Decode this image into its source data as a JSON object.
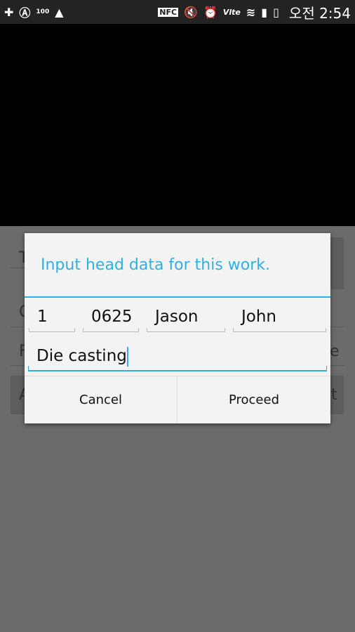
{
  "status_bar": {
    "icons": [
      "plus-icon",
      "a-circle-icon",
      "battery-100-icon",
      "warning-icon",
      "nfc-icon",
      "mute-icon",
      "alarm-icon",
      "volte-icon",
      "wifi-lock-icon",
      "signal-icon",
      "battery-charging-icon"
    ],
    "nfc": "NFC",
    "volte": "Vlte",
    "battery_label": "100",
    "time": "오전 2:54"
  },
  "background": {
    "fragments": [
      "T",
      "C",
      "F",
      "e",
      "A",
      "t"
    ]
  },
  "dialog": {
    "title": "Input head data for this work.",
    "fields": [
      "1",
      "0625",
      "Jason",
      "John"
    ],
    "description": "Die casting",
    "cancel": "Cancel",
    "proceed": "Proceed",
    "accent": "#2fb0e0"
  }
}
